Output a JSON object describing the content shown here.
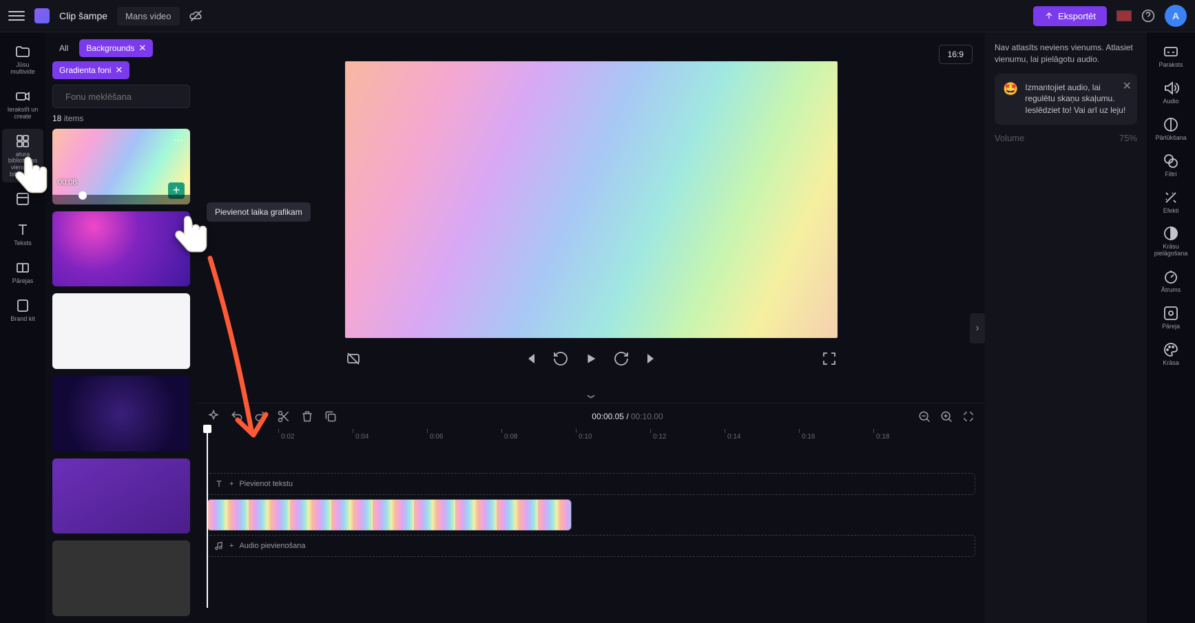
{
  "header": {
    "app_name": "Clip šampe",
    "project_name": "Mans video",
    "export_label": "Eksportēt",
    "avatar_initial": "A"
  },
  "leftnav": {
    "items": [
      {
        "label": "Jūsu multivide"
      },
      {
        "label": "Ierakstīt un create"
      },
      {
        "label": "atura bibliotēkas vienumu bibliotēka"
      },
      {
        "label": ""
      },
      {
        "label": "Teksts"
      },
      {
        "label": "Pārejas"
      },
      {
        "label": "Brand kit"
      }
    ]
  },
  "asset_panel": {
    "chip_all": "All",
    "chip_backgrounds": "Backgrounds",
    "chip_gradient": "Gradienta foni",
    "search_placeholder": "Fonu meklēšana",
    "item_count_num": "18",
    "item_count_label": "items",
    "thumb_duration": "00:08",
    "add_tooltip": "Pievienot laika grafikam"
  },
  "preview": {
    "aspect": "16:9"
  },
  "timeline": {
    "current_time": "00:00.05",
    "total_time": "00:10.00",
    "ticks": [
      "0:02",
      "0:04",
      "0:06",
      "0:08",
      "0:10",
      "0:12",
      "0:14",
      "0:16",
      "0:18"
    ],
    "text_track_label": "Pievienot tekstu",
    "audio_track_label": "Audio pievienošana"
  },
  "right_panel": {
    "empty_text": "Nav atlasīts neviens vienums. Atlasiet vienumu, lai pielāgotu audio.",
    "tip_text": "Izmantojiet audio, lai regulētu skaņu skaļumu. Ieslēdziet to! Vai arī uz leju!",
    "volume_label": "Volume",
    "volume_value": "75%"
  },
  "right_tools": {
    "items": [
      {
        "label": "Paraksts"
      },
      {
        "label": "Audio"
      },
      {
        "label": "Pārlūkšana"
      },
      {
        "label": "Filtri"
      },
      {
        "label": "Efekti"
      },
      {
        "label": "Krāsu pielāgošana"
      },
      {
        "label": "Ātrums"
      },
      {
        "label": "Pāreja"
      },
      {
        "label": "Krāsa"
      }
    ]
  }
}
